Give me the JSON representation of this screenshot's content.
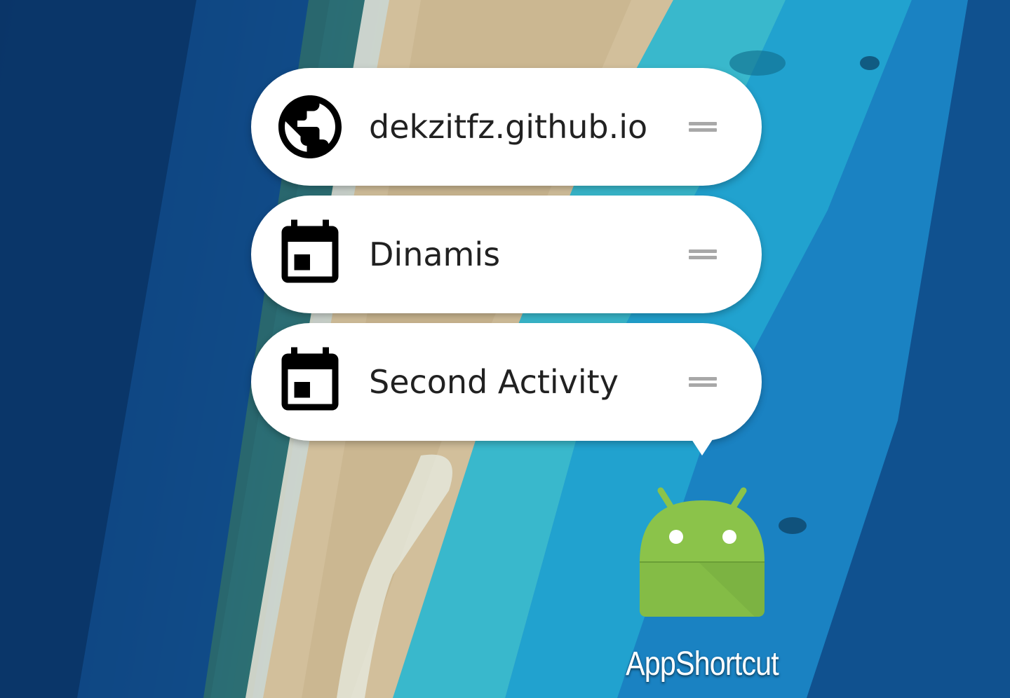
{
  "wallpaper": {
    "description_icon": "satellite-reef-wallpaper"
  },
  "shortcuts": [
    {
      "label": "dekzitfz.github.io",
      "icon": "globe-icon"
    },
    {
      "label": "Dinamis",
      "icon": "calendar-icon"
    },
    {
      "label": "Second Activity",
      "icon": "calendar-icon"
    }
  ],
  "app": {
    "name": "AppShortcut",
    "icon": "android-icon",
    "icon_color": "#8BC34A"
  },
  "colors": {
    "popup_bg": "#FFFFFF",
    "text": "#212121",
    "handle": "#A8A8A8"
  }
}
